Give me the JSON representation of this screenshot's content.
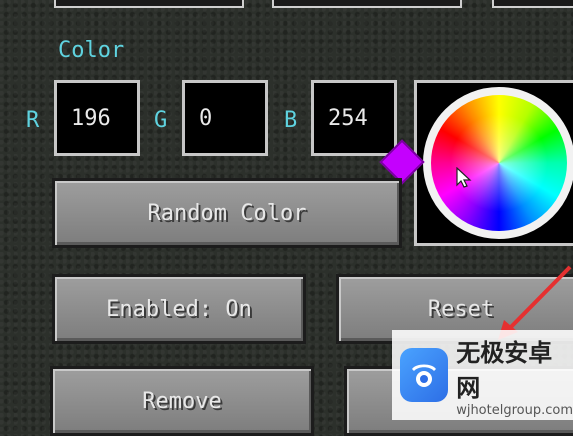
{
  "section_label": "Color",
  "channels": {
    "r": {
      "label": "R",
      "value": "196"
    },
    "g": {
      "label": "G",
      "value": "0"
    },
    "b": {
      "label": "B",
      "value": "254"
    }
  },
  "buttons": {
    "random_color": "Random Color",
    "enabled": "Enabled: On",
    "reset": "Reset",
    "remove": "Remove"
  },
  "colors": {
    "label_cyan": "#5fd3e0",
    "selected_marker": "#c400fe"
  },
  "watermark": {
    "brand": "无极安卓网",
    "url": "wjhotelgroup.com"
  }
}
